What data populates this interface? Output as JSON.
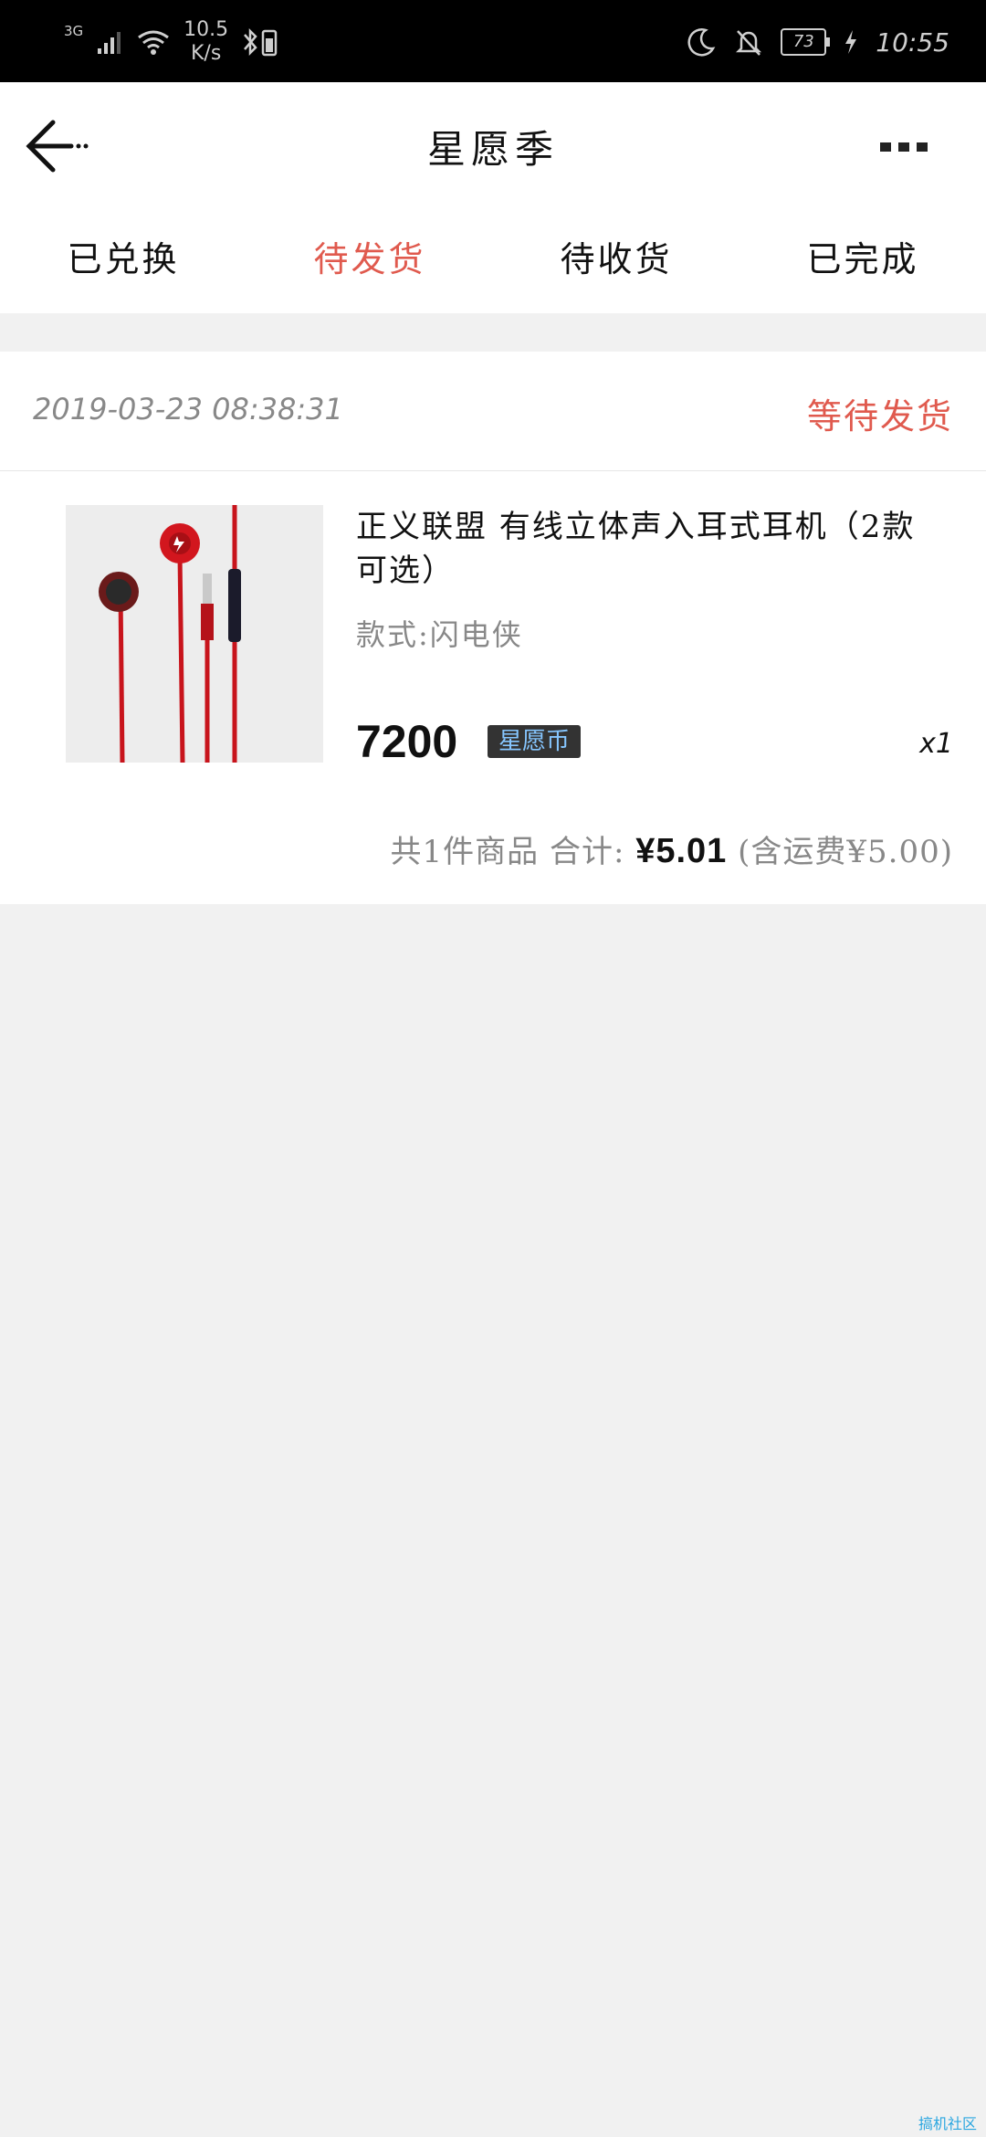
{
  "status_bar": {
    "network": "3G",
    "speed_value": "10.5",
    "speed_unit": "K/s",
    "battery": "73",
    "time": "10:55"
  },
  "header": {
    "title": "星愿季"
  },
  "tabs": [
    {
      "label": "已兑换",
      "active": false
    },
    {
      "label": "待发货",
      "active": true
    },
    {
      "label": "待收货",
      "active": false
    },
    {
      "label": "已完成",
      "active": false
    }
  ],
  "order": {
    "date": "2019-03-23  08:38:31",
    "status": "等待发货",
    "product_name": "正义联盟 有线立体声入耳式耳机（2款可选）",
    "spec": "款式:闪电侠",
    "price": "7200",
    "currency": "星愿币",
    "quantity": "x1",
    "summary_prefix": "共1件商品  合计:",
    "summary_total": "¥5.01",
    "summary_shipping": "(含运费¥5.00)"
  },
  "colors": {
    "accent": "#e05a4e",
    "background": "#f1f1f1",
    "coin_text": "#86c6ff"
  },
  "icons": {
    "back": "arrow-left-icon",
    "more": "more-dots-icon"
  },
  "watermark": "搞机社区"
}
